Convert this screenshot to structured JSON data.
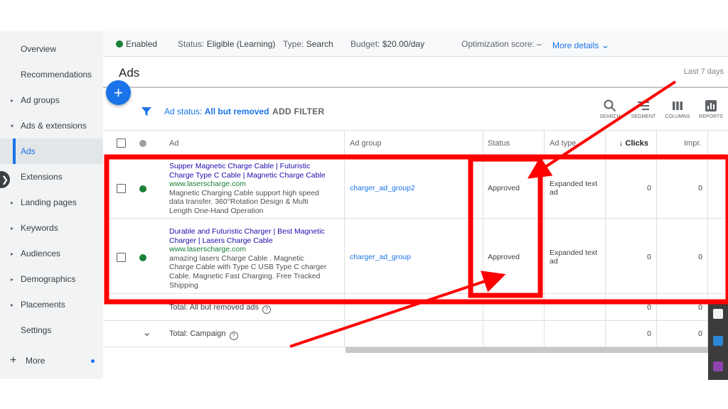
{
  "sidebar": {
    "items": [
      {
        "label": "Overview",
        "caret": ""
      },
      {
        "label": "Recommendations",
        "caret": ""
      },
      {
        "label": "Ad groups",
        "caret": "▸"
      },
      {
        "label": "Ads & extensions",
        "caret": "▾"
      },
      {
        "label": "Ads",
        "caret": ""
      },
      {
        "label": "Extensions",
        "caret": ""
      },
      {
        "label": "Landing pages",
        "caret": "▸"
      },
      {
        "label": "Keywords",
        "caret": "▸"
      },
      {
        "label": "Audiences",
        "caret": "▸"
      },
      {
        "label": "Demographics",
        "caret": "▸"
      },
      {
        "label": "Placements",
        "caret": "▸"
      },
      {
        "label": "Settings",
        "caret": ""
      }
    ],
    "more_label": "More",
    "more_plus": "+",
    "collapse_glyph": "❯"
  },
  "statusbar": {
    "enabled": "Enabled",
    "status_label": "Status:",
    "status_value": "Eligible (Learning)",
    "type_label": "Type:",
    "type_value": "Search",
    "budget_label": "Budget:",
    "budget_value": "$20.00/day",
    "opt_label": "Optimization score:",
    "opt_value": "–",
    "more_details": "More details",
    "chevron": "⌄"
  },
  "header": {
    "title": "Ads",
    "date_range": "Last 7 days"
  },
  "toolbar": {
    "add_glyph": "+",
    "filter_label": "Ad status:",
    "filter_value": "All but removed",
    "add_filter": "ADD FILTER",
    "tools": [
      "SEARCH",
      "SEGMENT",
      "COLUMNS",
      "REPORTS"
    ]
  },
  "table": {
    "columns": {
      "ad": "Ad",
      "ad_group": "Ad group",
      "status": "Status",
      "ad_type": "Ad type",
      "clicks": "↓ Clicks",
      "impr": "Impr."
    },
    "rows": [
      {
        "headline1": "Supper Magnetic Charge Cable | Futuristic",
        "headline2": "Charge Type C Cable | Magnetic Charge Cable",
        "url": "www.laserscharge.com",
        "desc1": "Magnetic Charging Cable support high speed",
        "desc2": "data transfer. 360°Rotation Design & Multi",
        "desc3": "Length One-Hand Operation",
        "desc4": "",
        "ad_group": "charger_ad_group2",
        "status": "Approved",
        "ad_type1": "Expanded text",
        "ad_type2": "ad",
        "clicks": "0",
        "impr": "0"
      },
      {
        "headline1": "Durable and Futuristic Charger | Best Magnetic",
        "headline2": "Charger | Lasers Charge Cable",
        "url": "www.laserscharge.com",
        "desc1": "amazing lasers Charge Cable . Magnetic",
        "desc2": "Charge Cable with Type C USB Type C charger",
        "desc3": "Cable. Magnetic Fast Charging. Free Tracked",
        "desc4": "Shipping",
        "ad_group": "charger_ad_group",
        "status": "Approved",
        "ad_type1": "Expanded text",
        "ad_type2": "ad",
        "clicks": "0",
        "impr": "0"
      }
    ],
    "totals": [
      {
        "label": "Total: All but removed ads",
        "help": "?",
        "clicks": "0",
        "impr": "0"
      },
      {
        "label": "Total: Campaign",
        "help": "?",
        "clicks": "0",
        "impr": "0",
        "chevron": "⌄"
      }
    ]
  },
  "colors": {
    "accent": "#1a73e8",
    "green": "#188038",
    "annotation": "#ff0000"
  }
}
